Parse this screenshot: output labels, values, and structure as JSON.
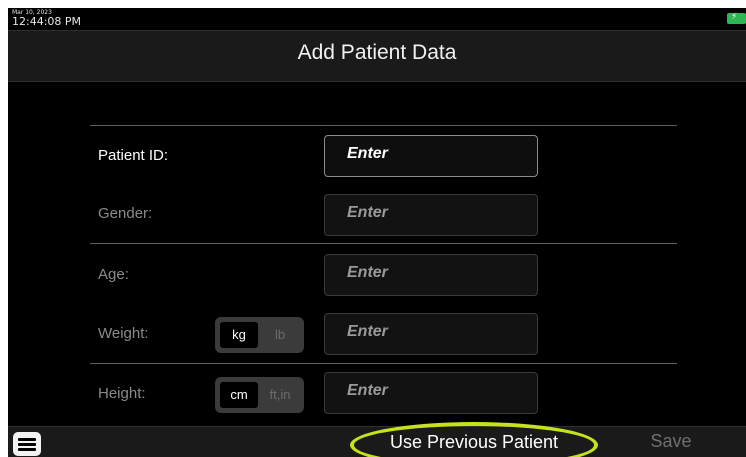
{
  "status": {
    "date": "Mar 10, 2023",
    "time": "12:44:08 PM",
    "battery_color": "#2fb553"
  },
  "header": {
    "title": "Add Patient Data"
  },
  "form": {
    "patient_id": {
      "label": "Patient ID:",
      "value": "Enter"
    },
    "gender": {
      "label": "Gender:",
      "value": "Enter"
    },
    "age": {
      "label": "Age:",
      "value": "Enter"
    },
    "weight": {
      "label": "Weight:",
      "value": "Enter",
      "units": [
        "kg",
        "lb"
      ],
      "selected_unit": "kg"
    },
    "height": {
      "label": "Height:",
      "value": "Enter",
      "units": [
        "cm",
        "ft,in"
      ],
      "selected_unit": "cm"
    }
  },
  "bottombar": {
    "menu_icon": "hamburger-icon",
    "use_previous_label": "Use Previous Patient",
    "save_label": "Save",
    "highlight_color": "#c6e21a"
  }
}
